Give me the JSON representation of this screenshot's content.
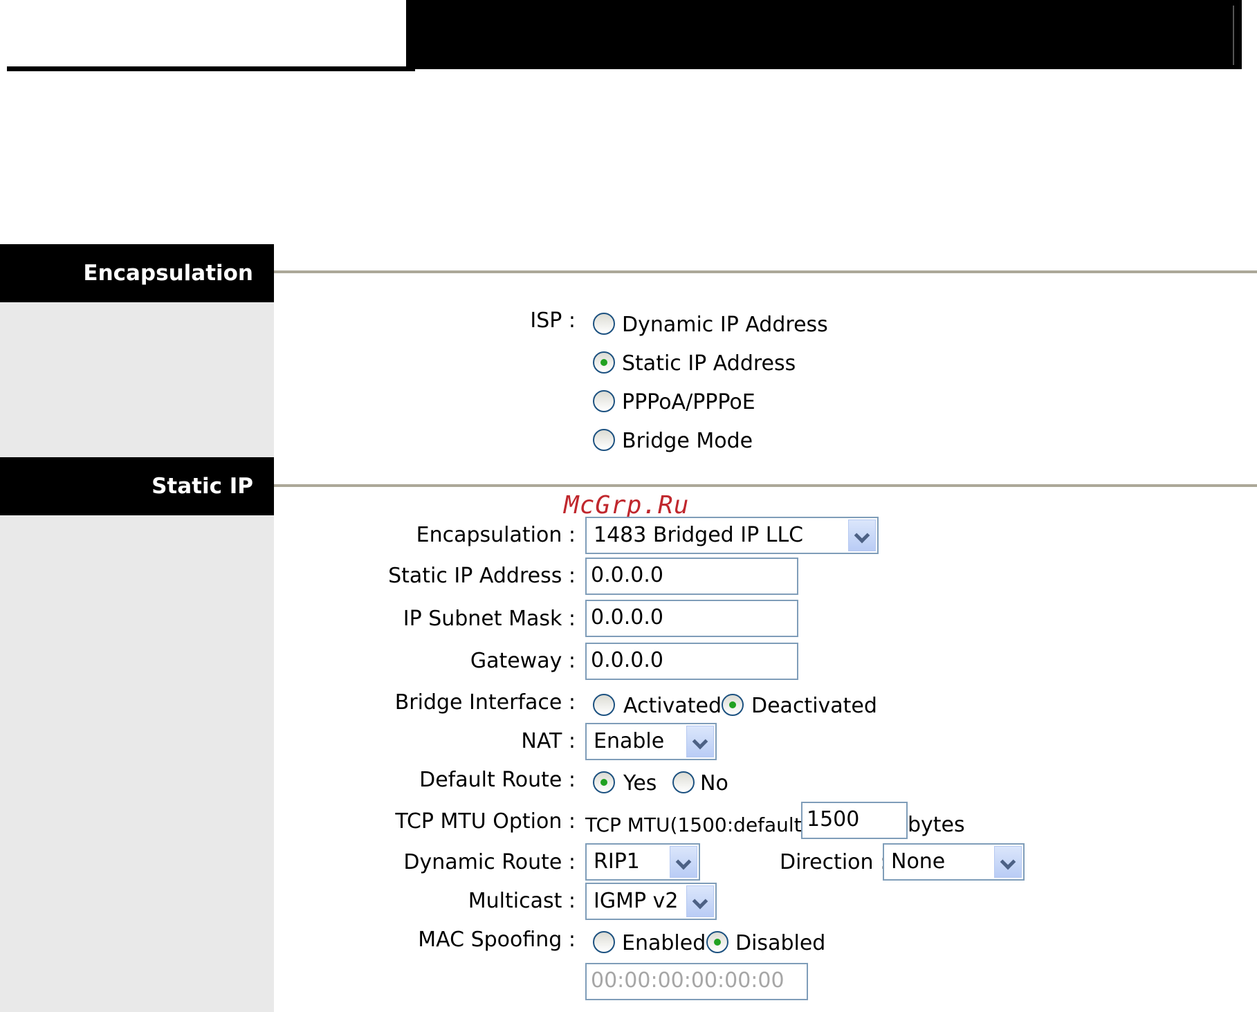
{
  "sections": {
    "encapsulation_title": "Encapsulation",
    "static_ip_title": "Static IP"
  },
  "watermark": "McGrp.Ru",
  "isp": {
    "label": "ISP :",
    "options": [
      "Dynamic IP Address",
      "Static IP Address",
      "PPPoA/PPPoE",
      "Bridge Mode"
    ],
    "selected": "Static IP Address"
  },
  "static_ip": {
    "encapsulation": {
      "label": "Encapsulation :",
      "value": "1483 Bridged IP LLC"
    },
    "static_ip_address": {
      "label": "Static IP Address :",
      "value": "0.0.0.0"
    },
    "ip_subnet_mask": {
      "label": "IP Subnet Mask :",
      "value": "0.0.0.0"
    },
    "gateway": {
      "label": "Gateway :",
      "value": "0.0.0.0"
    },
    "bridge_interface": {
      "label": "Bridge Interface :",
      "options": [
        "Activated",
        "Deactivated"
      ],
      "selected": "Deactivated"
    },
    "nat": {
      "label": "NAT :",
      "value": "Enable"
    },
    "default_route": {
      "label": "Default Route :",
      "options": [
        "Yes",
        "No"
      ],
      "selected": "Yes"
    },
    "tcp_mtu": {
      "label": "TCP MTU Option :",
      "prefix": "TCP MTU(1500:default)",
      "value": "1500",
      "unit": "bytes"
    },
    "dynamic_route": {
      "label": "Dynamic Route :",
      "value": "RIP1"
    },
    "direction": {
      "label": "Direction :",
      "value": "None"
    },
    "multicast": {
      "label": "Multicast :",
      "value": "IGMP v2"
    },
    "mac_spoofing": {
      "label": "MAC Spoofing :",
      "options": [
        "Enabled",
        "Disabled"
      ],
      "selected": "Disabled",
      "mac_value": "00:00:00:00:00:00"
    }
  },
  "colors": {
    "radio_dot": "#21a121",
    "input_border": "#7f9db9",
    "section_bg": "#000000",
    "panel_bg": "#e9e9e9"
  }
}
